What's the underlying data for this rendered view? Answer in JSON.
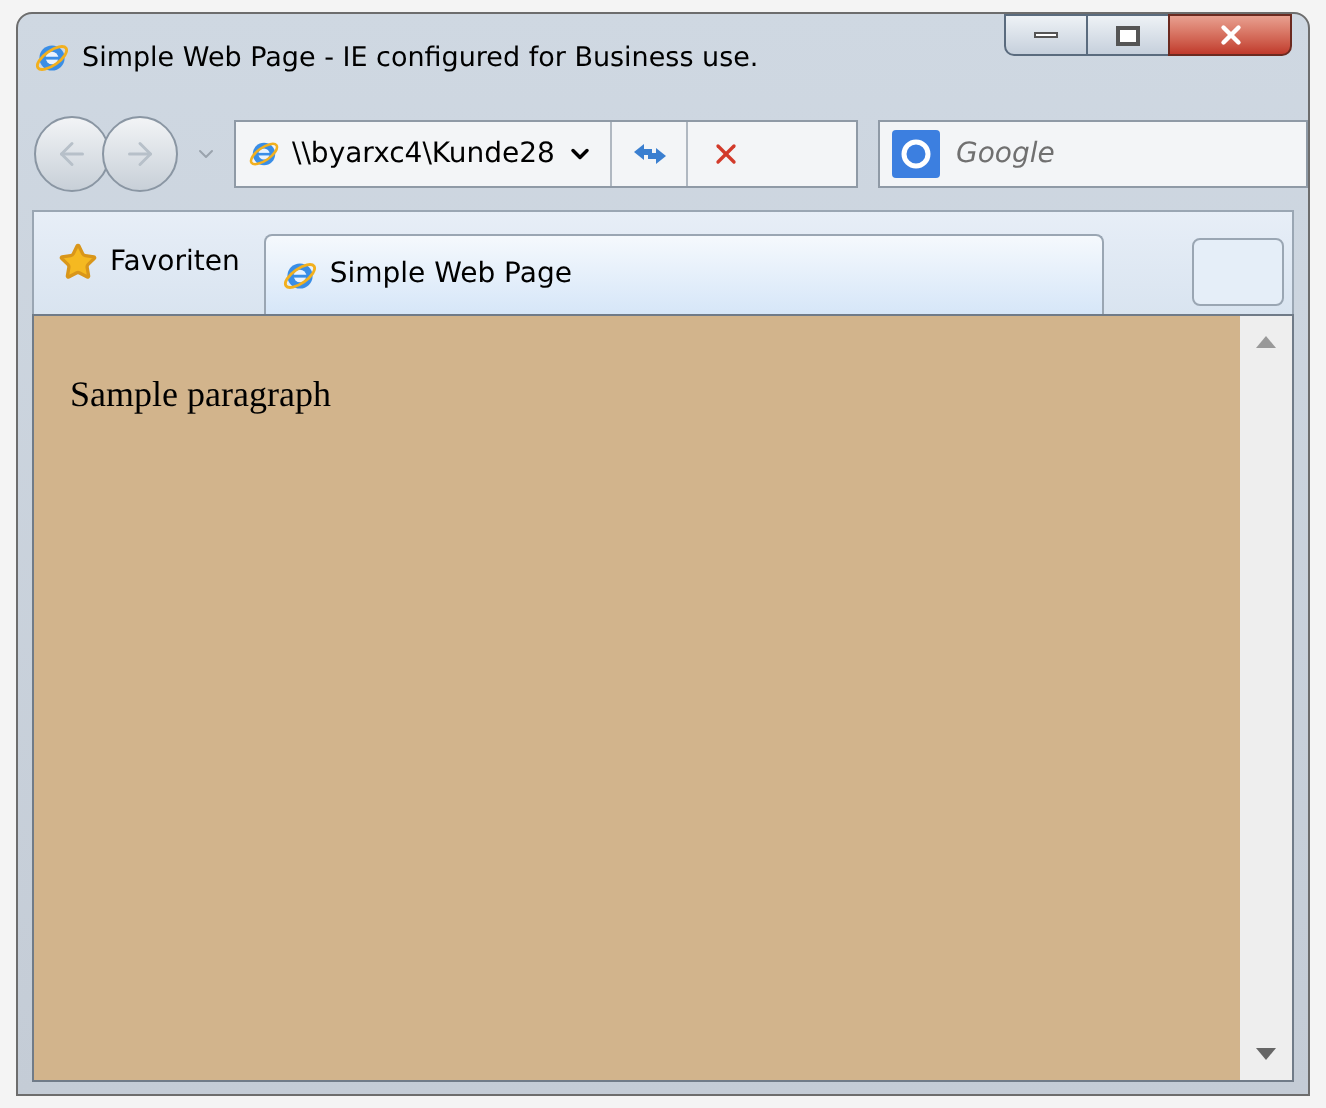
{
  "window": {
    "title": "Simple Web Page - IE configured for Business use."
  },
  "address_bar": {
    "value": "\\\\byarxc4\\Kunde28"
  },
  "search": {
    "placeholder": "Google"
  },
  "favorites": {
    "label": "Favoriten"
  },
  "tabs": [
    {
      "label": "Simple Web Page",
      "selected": true
    }
  ],
  "page": {
    "paragraph": "Sample paragraph"
  }
}
